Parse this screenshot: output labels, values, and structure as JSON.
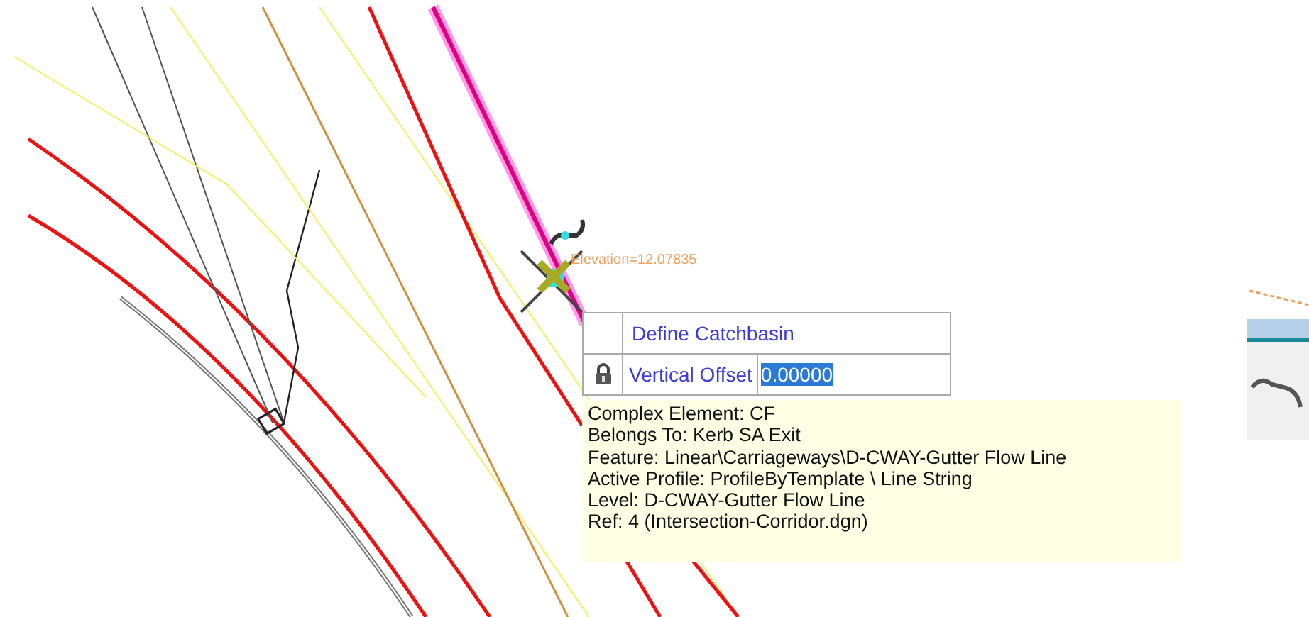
{
  "snap_readout": {
    "text": "Elevation=12.07835"
  },
  "tool_prompt": {
    "title": "Define Catchbasin",
    "fields": [
      {
        "label": "Vertical Offset",
        "value": "0.00000",
        "locked": true,
        "selected": true
      }
    ]
  },
  "element_info": {
    "lines": [
      "Complex Element: CF",
      "Belongs To: Kerb SA Exit",
      "Feature: Linear\\Carriageways\\D-CWAY-Gutter Flow Line",
      "Active Profile: ProfileByTemplate \\ Line String",
      "Level: D-CWAY-Gutter Flow Line",
      "Ref: 4 (Intersection-Corridor.dgn)"
    ]
  }
}
